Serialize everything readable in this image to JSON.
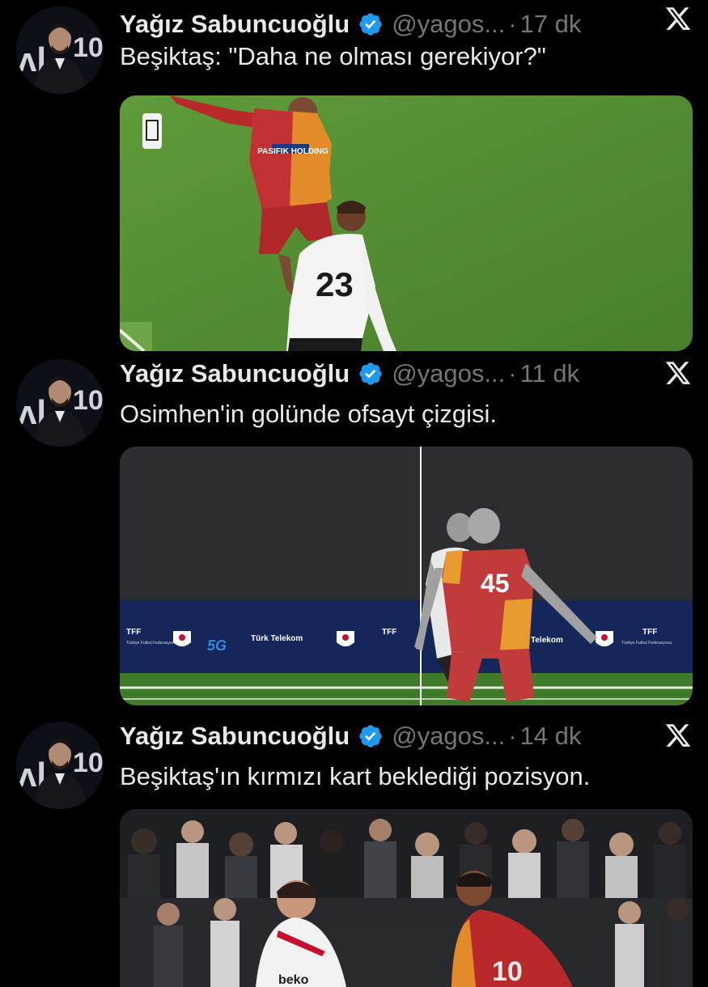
{
  "tweets": [
    {
      "name": "Yağız Sabuncuoğlu",
      "handle": "@yagos...",
      "separator": "·",
      "time": "17 dk",
      "text": "Beşiktaş: \"Daha ne olması gerekiyor?\"",
      "media": {
        "jersey_number": "23",
        "sponsor": "PASIFIK HOLDING"
      }
    },
    {
      "name": "Yağız Sabuncuoğlu",
      "handle": "@yagos...",
      "separator": "·",
      "time": "11 dk",
      "text": "Osimhen'in golünde ofsayt çizgisi.",
      "media": {
        "jersey_number": "45",
        "board_tff": "TFF",
        "board_tff_sub": "Türkiye Futbol Federasyonu",
        "board_telekom": "Türk Telekom",
        "board_telekom_short": "Telekom",
        "board_5g": "5G"
      }
    },
    {
      "name": "Yağız Sabuncuoğlu",
      "handle": "@yagos...",
      "separator": "·",
      "time": "14 dk",
      "text": "Beşiktaş'ın kırmızı kart beklediği pozisyon.",
      "media": {
        "jersey_number": "10",
        "shirt_text": "beko"
      }
    }
  ],
  "colors": {
    "background": "#000000",
    "text": "#e7e9ea",
    "secondary": "#71767b",
    "verified": "#1d9bf0"
  }
}
